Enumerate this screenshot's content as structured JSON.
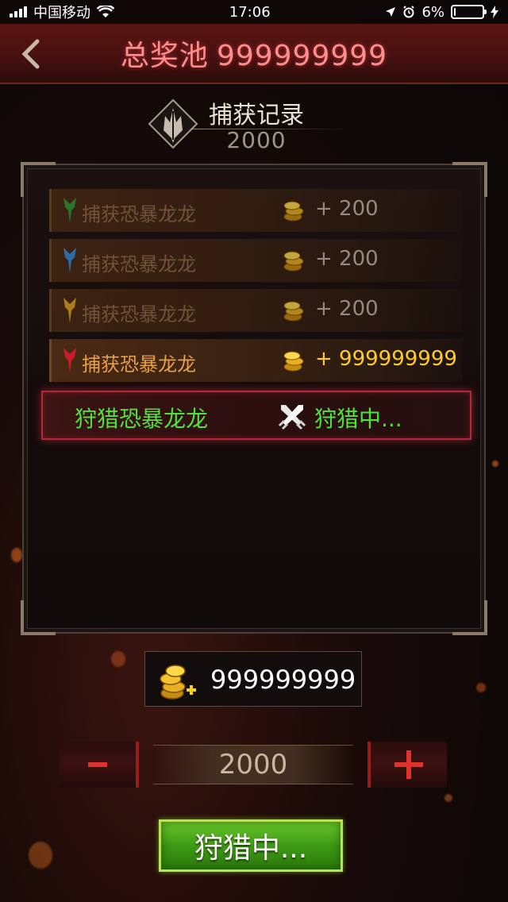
{
  "status_bar": {
    "carrier": "中国移动",
    "time": "17:06",
    "battery_text": "6%",
    "battery_level": 0.06
  },
  "header": {
    "title": "总奖池",
    "pool_value": "999999999"
  },
  "record": {
    "title": "捕获记录",
    "count": "2000"
  },
  "records": [
    {
      "icon": "green-dragon-icon",
      "color": "#2e9a36",
      "label": "捕获恐暴龙龙",
      "reward": "+ 200"
    },
    {
      "icon": "blue-dragon-icon",
      "color": "#2f8fd8",
      "label": "捕获恐暴龙龙",
      "reward": "+ 200"
    },
    {
      "icon": "yellow-dragon-icon",
      "color": "#e0a020",
      "label": "捕获恐暴龙龙",
      "reward": "+ 200"
    },
    {
      "icon": "red-dragon-icon",
      "color": "#c81e2a",
      "label": "捕获恐暴龙龙",
      "reward": "+ 999999999"
    }
  ],
  "hunting": {
    "label": "狩猎恐暴龙龙",
    "status": "狩猎中..."
  },
  "balance": {
    "value": "999999999"
  },
  "stepper": {
    "minus_label": "-",
    "value": "2000",
    "plus_label": "+"
  },
  "hunt_button": {
    "label": "狩猎中..."
  },
  "colors": {
    "title_red": "#ff8d8d",
    "hunting_green": "#4fe23a",
    "gold": "#ffcc22"
  }
}
